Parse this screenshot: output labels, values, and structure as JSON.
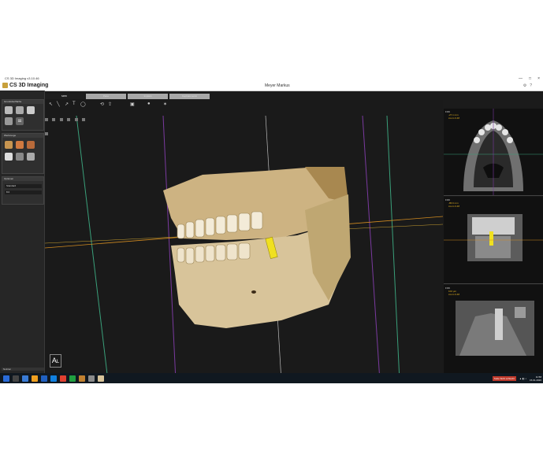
{
  "window": {
    "title": "CS 3D Imaging v3.10.46",
    "controls": [
      "—",
      "□",
      "×"
    ]
  },
  "app": {
    "logo_text": "CS 3D Imaging",
    "patient_name": "Meyer Markus",
    "analysis_date": "Analyse 27.08.2019"
  },
  "tabs": [
    {
      "label": "MPR",
      "active": true
    },
    {
      "label": "Pano",
      "active": false
    },
    {
      "label": "Implant",
      "active": false
    },
    {
      "label": "Cephalometric",
      "active": false
    }
  ],
  "sidebar": {
    "sections": [
      {
        "title": "Grundoberfläche"
      },
      {
        "title": "Werkzeuge"
      },
      {
        "title": "Optionen"
      }
    ],
    "option_value": "Standard",
    "option_value2": "8.0",
    "bottom_label": "Notizen"
  },
  "viewport": {
    "overlay_text": "A",
    "overlay_text2": "L"
  },
  "right_views": [
    {
      "corner": "FOK",
      "line1": "-27.1 mm",
      "line2": "zoom 0.48"
    },
    {
      "corner": "FOK",
      "line1": "-86.6 mm",
      "line2": "zoom 0.48"
    },
    {
      "corner": "FOK",
      "line1": "102 µm",
      "line2": "zoom 0.48"
    }
  ],
  "taskbar": {
    "notification": "Suite Sicht schlecht",
    "time": "11:58",
    "date": "15.01.2020"
  },
  "colors": {
    "screen_bg": "#1b1b1b",
    "bone": "#d8c49a",
    "implant": "#f0e020",
    "guide_green": "#3aa07a",
    "guide_purple": "#7a3aa0",
    "guide_orange": "#d08a20"
  }
}
